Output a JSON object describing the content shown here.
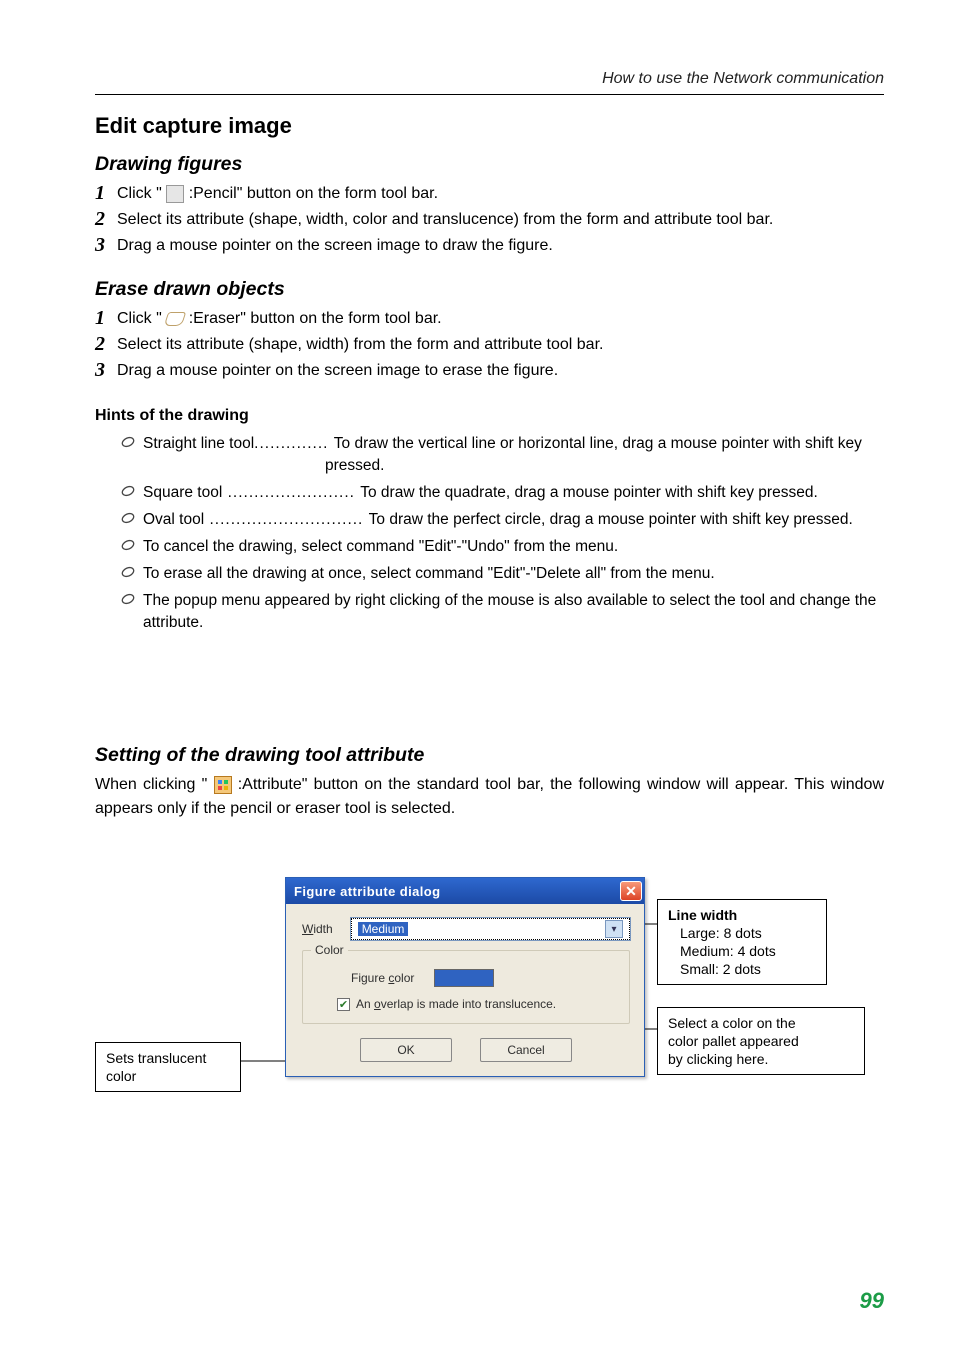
{
  "header": {
    "title": "How to use the Network  communication"
  },
  "section": {
    "title": "Edit capture image"
  },
  "drawing": {
    "heading": "Drawing figures",
    "steps": [
      {
        "num": "1",
        "pre": " Click \" ",
        "post": " :Pencil\" button on the form tool bar."
      },
      {
        "num": "2",
        "text": " Select its attribute (shape, width, color and translucence) from the form and attribute tool bar."
      },
      {
        "num": "3",
        "text": " Drag a mouse pointer on the screen image to draw the figure."
      }
    ]
  },
  "erase": {
    "heading": "Erase drawn objects",
    "steps": [
      {
        "num": "1",
        "pre": " Click \" ",
        "post": " :Eraser\" button on the form tool bar."
      },
      {
        "num": "2",
        "text": " Select its attribute (shape, width) from the form and attribute tool bar."
      },
      {
        "num": "3",
        "text": " Drag a mouse pointer on the screen image to erase the figure."
      }
    ]
  },
  "hints": {
    "heading": "Hints of the drawing",
    "items": [
      {
        "name": "Straight line tool",
        "dots": ".............. ",
        "desc1": "To draw the vertical line or horizontal line, drag a mouse pointer with shift key",
        "desc2": "pressed."
      },
      {
        "name": "Square tool",
        "dots": " ........................ ",
        "desc": "To draw the quadrate, drag a mouse pointer with shift key pressed."
      },
      {
        "name": "Oval tool",
        "dots": " ............................. ",
        "desc": "To draw the perfect circle, drag a mouse pointer with shift key pressed."
      },
      {
        "desc": "To cancel the drawing, select command \"Edit\"-\"Undo\" from the menu."
      },
      {
        "desc": "To erase all the drawing at once, select command \"Edit\"-\"Delete all\" from the menu."
      },
      {
        "desc": "The popup menu appeared by right clicking of the mouse is also available to select the tool and change the attribute."
      }
    ]
  },
  "attribute": {
    "heading": "Setting of the drawing tool attribute",
    "body1": "When clicking \" ",
    "body2": " :Attribute\" button on the standard tool bar, the following window will appear. This window appears only if the pencil or eraser tool is selected."
  },
  "dialog": {
    "title": "Figure attribute dialog",
    "width_u": "W",
    "width_rest": "idth",
    "width_value": "Medium",
    "color_group": "Color",
    "figcol_pre": "Figure ",
    "figcol_u": "c",
    "figcol_post": "olor",
    "chk_pre": " An ",
    "chk_u": "o",
    "chk_post": "verlap is made into translucence.",
    "ok": "OK",
    "cancel": "Cancel"
  },
  "callouts": {
    "left": {
      "line1": "Sets translucent",
      "line2": "color"
    },
    "right1": {
      "title": "Line width",
      "line1": "Large: 8 dots",
      "line2": "Medium: 4 dots",
      "line3": "Small: 2 dots"
    },
    "right2": {
      "line1": "Select a color on the",
      "line2": "color pallet appeared",
      "line3": "by clicking here."
    }
  },
  "footer": {
    "page": "99"
  }
}
